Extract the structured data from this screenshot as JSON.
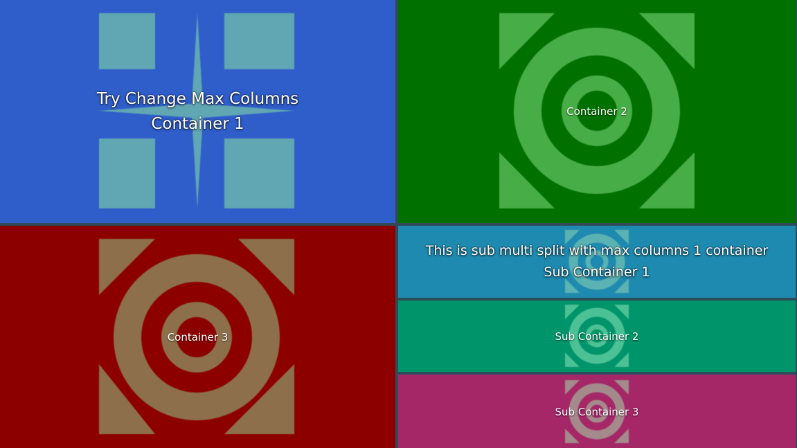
{
  "containers": {
    "c1": {
      "line1": "Try Change Max Columns",
      "line2": "Container 1",
      "color": "#2f5ecb",
      "art_color": "#61a6b3",
      "icon": "star-icon"
    },
    "c2": {
      "label": "Container 2",
      "color": "#007000",
      "art_color": "#47ae47",
      "icon": "target-icon"
    },
    "c3": {
      "label": "Container 3",
      "color": "#8c0000",
      "art_color": "#8d704b",
      "icon": "target-icon"
    }
  },
  "sub_split": {
    "sc1": {
      "line1": "This is sub multi split with max columns 1 container",
      "line2": "Sub Container 1",
      "color": "#1f8aaf",
      "art_color": "#5bb2b3",
      "icon": "target-icon"
    },
    "sc2": {
      "label": "Sub Container 2",
      "color": "#00946a",
      "art_color": "#4cc195",
      "icon": "target-icon"
    },
    "sc3": {
      "label": "Sub Container 3",
      "color": "#a52768",
      "art_color": "#a48a8a",
      "icon": "target-icon"
    }
  },
  "divider_color": "#2f4a58"
}
